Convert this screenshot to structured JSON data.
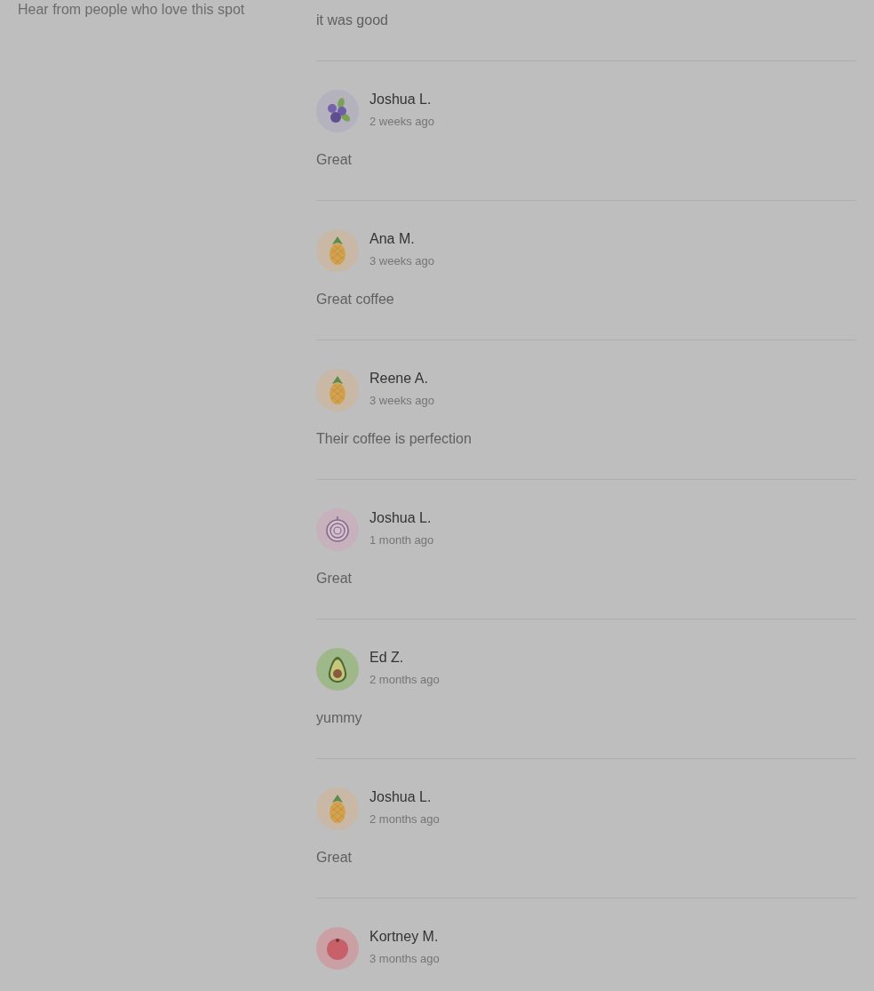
{
  "sidebar": {
    "subtitle": "Hear from people who love this spot"
  },
  "reviews": [
    {
      "text": "it was good"
    },
    {
      "name": "Joshua L.",
      "time": "2 weeks ago",
      "avatar": {
        "kind": "blueberry"
      },
      "text": "Great"
    },
    {
      "name": "Ana M.",
      "time": "3 weeks ago",
      "avatar": {
        "kind": "pineapple"
      },
      "text": "Great coffee"
    },
    {
      "name": "Reene A.",
      "time": "3 weeks ago",
      "avatar": {
        "kind": "pineapple"
      },
      "text": "Their coffee is perfection"
    },
    {
      "name": "Joshua L.",
      "time": "1 month ago",
      "avatar": {
        "kind": "onion"
      },
      "text": "Great"
    },
    {
      "name": "Ed Z.",
      "time": "2 months ago",
      "avatar": {
        "kind": "avocado"
      },
      "text": "yummy"
    },
    {
      "name": "Joshua L.",
      "time": "2 months ago",
      "avatar": {
        "kind": "pineapple"
      },
      "text": "Great"
    },
    {
      "name": "Kortney M.",
      "time": "3 months ago",
      "avatar": {
        "kind": "tomato"
      }
    }
  ]
}
